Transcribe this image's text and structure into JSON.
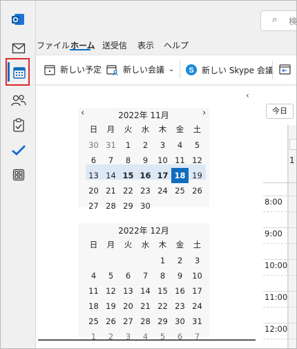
{
  "rail": {
    "icons": [
      "outlook-logo",
      "mail-icon",
      "calendar-icon",
      "people-icon",
      "tasks-icon",
      "todo-check-icon",
      "apps-icon"
    ]
  },
  "search": {
    "placeholder": "検"
  },
  "menu": {
    "items": [
      "ファイル",
      "ホーム",
      "送受信",
      "表示",
      "ヘルプ"
    ],
    "active": "ホーム"
  },
  "ribbon": {
    "new_appointment": "新しい予定",
    "new_meeting": "新しい会議",
    "new_skype_meeting": "新しい Skype 会議"
  },
  "calendar": {
    "weekdays": [
      "日",
      "月",
      "火",
      "水",
      "木",
      "金",
      "土"
    ],
    "months": [
      {
        "title": "2022年 11月",
        "weeks": [
          [
            "30",
            "31",
            "1",
            "2",
            "3",
            "4",
            "5"
          ],
          [
            "6",
            "7",
            "8",
            "9",
            "10",
            "11",
            "12"
          ],
          [
            "13",
            "14",
            "15",
            "16",
            "17",
            "18",
            "19"
          ],
          [
            "20",
            "21",
            "22",
            "23",
            "24",
            "25",
            "26"
          ],
          [
            "27",
            "28",
            "29",
            "30",
            "",
            "",
            ""
          ]
        ]
      },
      {
        "title": "2022年 12月",
        "weeks": [
          [
            "",
            "",
            "",
            "",
            "1",
            "2",
            "3"
          ],
          [
            "4",
            "5",
            "6",
            "7",
            "8",
            "9",
            "10"
          ],
          [
            "11",
            "12",
            "13",
            "14",
            "15",
            "16",
            "17"
          ],
          [
            "18",
            "19",
            "20",
            "21",
            "22",
            "23",
            "24"
          ],
          [
            "25",
            "26",
            "27",
            "28",
            "29",
            "30",
            "31"
          ],
          [
            "1",
            "2",
            "3",
            "4",
            "5",
            "6",
            "7"
          ]
        ]
      }
    ],
    "selected_week": "2022年 11月 13–19",
    "today": "18"
  },
  "dayview": {
    "today_label": "今日",
    "allday_fragment": "1",
    "times": [
      "8:00",
      "9:00",
      "10:00",
      "11:00",
      "12:00"
    ]
  },
  "colors": {
    "accent": "#0f6cbd",
    "highlight_box": "#e0262b",
    "week_band": "#dde8f6"
  }
}
